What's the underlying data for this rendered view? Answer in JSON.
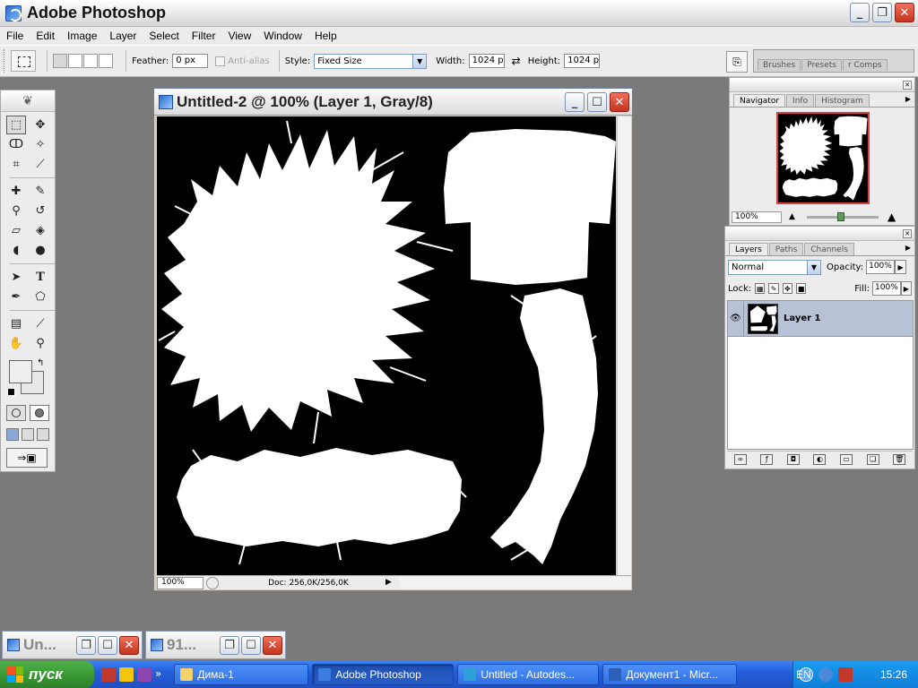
{
  "app": {
    "title": "Adobe Photoshop"
  },
  "menu": [
    "File",
    "Edit",
    "Image",
    "Layer",
    "Select",
    "Filter",
    "View",
    "Window",
    "Help"
  ],
  "options": {
    "feather_label": "Feather:",
    "feather_value": "0 px",
    "antialias_label": "Anti-alias",
    "style_label": "Style:",
    "style_value": "Fixed Size",
    "width_label": "Width:",
    "width_value": "1024 p:",
    "height_label": "Height:",
    "height_value": "1024 p:",
    "palette_well_tabs": [
      "Brushes",
      "Presets",
      "r Comps"
    ]
  },
  "document": {
    "title": "Untitled-2 @ 100% (Layer 1, Gray/8)",
    "zoom": "100%",
    "doc_info": "Doc: 256,0K/256,0K"
  },
  "navigator": {
    "tabs": [
      "Navigator",
      "Info",
      "Histogram"
    ],
    "zoom": "100%"
  },
  "layers": {
    "tabs": [
      "Layers",
      "Paths",
      "Channels"
    ],
    "blend_mode": "Normal",
    "opacity_label": "Opacity:",
    "opacity_value": "100%",
    "lock_label": "Lock:",
    "fill_label": "Fill:",
    "fill_value": "100%",
    "layer_name": "Layer 1"
  },
  "minimized": [
    {
      "title": "Un..."
    },
    {
      "title": "91..."
    }
  ],
  "taskbar": {
    "start": "пуск",
    "tasks": [
      {
        "label": "Дима-1",
        "icon_color": "#f5d36b"
      },
      {
        "label": "Adobe Photoshop",
        "icon_color": "#3a7de0"
      },
      {
        "label": "Untitled - Autodes...",
        "icon_color": "#2fa0d8"
      },
      {
        "label": "Документ1 - Micr...",
        "icon_color": "#2b5fb8"
      }
    ],
    "lang": "EN",
    "clock": "15:26"
  },
  "colors": {
    "canvas": "#000000",
    "fur": "#ffffff",
    "workspace": "#7a7a7a",
    "taskbar": "#245edb",
    "start": "#3a9a35"
  }
}
